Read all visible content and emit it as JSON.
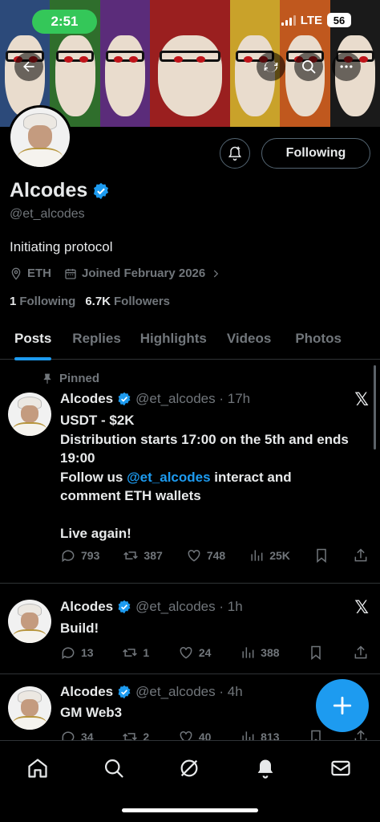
{
  "status_bar": {
    "time": "2:51",
    "network": "LTE",
    "battery": "56"
  },
  "profile": {
    "display_name": "Alcodes",
    "handle": "@et_alcodes",
    "bio": "Initiating protocol",
    "location": "ETH",
    "joined": "Joined February 2026",
    "following_count": "1",
    "following_label": "Following",
    "followers_count": "6.7K",
    "followers_label": "Followers",
    "follow_button_label": "Following"
  },
  "tabs": [
    {
      "label": "Posts",
      "active": true
    },
    {
      "label": "Replies"
    },
    {
      "label": "Highlights"
    },
    {
      "label": "Videos"
    },
    {
      "label": "Photos"
    }
  ],
  "posts": [
    {
      "pinned_label": "Pinned",
      "name": "Alcodes",
      "handle_time": "@et_alcodes · 17h",
      "line1": "USDT - $2K",
      "line2": "Distribution starts 17:00 on the 5th and ends 19:00",
      "line3_prefix": "Follow us ",
      "mention": "@et_alcodes",
      "line3_suffix": " interact and comment ETH wallets",
      "line4": "Live again!",
      "replies": "793",
      "reposts": "387",
      "likes": "748",
      "views": "25K"
    },
    {
      "name": "Alcodes",
      "handle_time": "@et_alcodes · 1h",
      "text": "Build!",
      "replies": "13",
      "reposts": "1",
      "likes": "24",
      "views": "388"
    },
    {
      "name": "Alcodes",
      "handle_time": "@et_alcodes · 4h",
      "text": "GM Web3",
      "replies": "34",
      "reposts": "2",
      "likes": "40",
      "views": "813"
    }
  ],
  "icons": {
    "back": "back-arrow-icon",
    "refresh": "refresh-icon",
    "search": "search-icon",
    "more": "more-icon",
    "notify": "bell-plus-icon",
    "verified": "verified-badge-icon",
    "x_logo": "x-logo-icon"
  },
  "colors": {
    "accent": "#1d9bf0",
    "text": "#e7e9ea",
    "muted": "#71767b",
    "divider": "#2f3336",
    "time_pill": "#34c759"
  },
  "x_logo_char": "𝕏",
  "nav": [
    "home",
    "search",
    "grok",
    "notifications",
    "messages"
  ]
}
